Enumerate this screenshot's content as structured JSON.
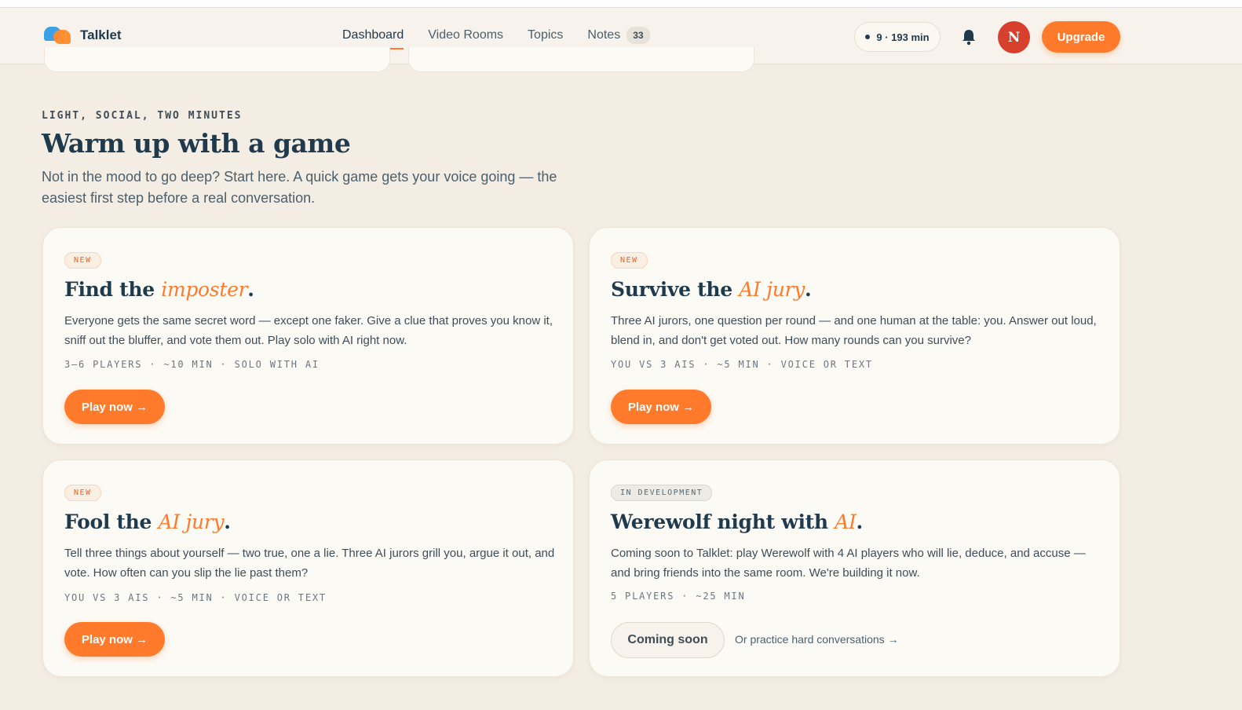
{
  "header": {
    "brand": "Talklet",
    "nav": [
      {
        "label": "Dashboard",
        "active": true
      },
      {
        "label": "Video Rooms"
      },
      {
        "label": "Topics"
      },
      {
        "label": "Notes",
        "count": "33"
      }
    ],
    "minutes": "9 · 193 min",
    "avatar_initial": "N",
    "upgrade_label": "Upgrade",
    "icons": {
      "bell": "bell-icon",
      "status": "status-dot-icon"
    }
  },
  "section": {
    "eyebrow": "LIGHT, SOCIAL, TWO MINUTES",
    "title": "Warm up with a game",
    "description": "Not in the mood to go deep? Start here. A quick game gets your voice going — the easiest first step before a real conversation."
  },
  "cards": [
    {
      "tag": "NEW",
      "title_pre": "Find the ",
      "title_accent": "imposter",
      "title_post": ".",
      "description": "Everyone gets the same secret word — except one faker. Give a clue that proves you know it, sniff out the bluffer, and vote them out. Play solo with AI right now.",
      "meta": "3–6 PLAYERS · ~10 MIN · SOLO WITH AI",
      "cta": "Play now →"
    },
    {
      "tag": "NEW",
      "title_pre": "Survive the ",
      "title_accent": "AI jury",
      "title_post": ".",
      "description": "Three AI jurors, one question per round — and one human at the table: you. Answer out loud, blend in, and don't get voted out. How many rounds can you survive?",
      "meta": "YOU VS 3 AIS · ~5 MIN · VOICE OR TEXT",
      "cta": "Play now →"
    },
    {
      "tag": "NEW",
      "title_pre": "Fool the ",
      "title_accent": "AI jury",
      "title_post": ".",
      "description": "Tell three things about yourself — two true, one a lie. Three AI jurors grill you, argue it out, and vote. How often can you slip the lie past them?",
      "meta": "YOU VS 3 AIS · ~5 MIN · VOICE OR TEXT",
      "cta": "Play now →"
    },
    {
      "tag": "IN DEVELOPMENT",
      "title_pre": "Werewolf night with ",
      "title_accent": "AI",
      "title_post": ".",
      "description": "Coming soon to Talklet: play Werewolf with 4 AI players who will lie, deduce, and accuse — and bring friends into the same room. We're building it now.",
      "meta": "5 PLAYERS · ~25 MIN",
      "cta": "Coming soon",
      "secondary_link": "Or practice hard conversations →"
    }
  ],
  "colors": {
    "accent": "#ff7a2a",
    "navy": "#1f3a4d",
    "background": "#f3ede3",
    "card": "#fcfaf5",
    "avatar": "#d8402e"
  }
}
